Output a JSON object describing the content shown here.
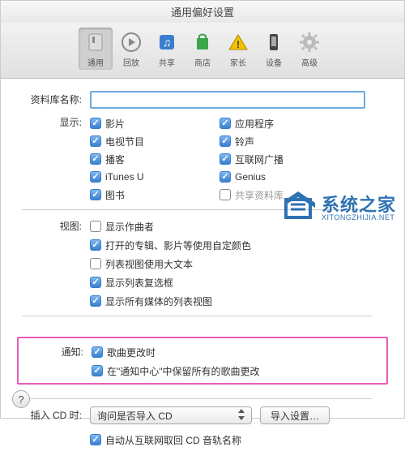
{
  "window": {
    "title": "通用偏好设置"
  },
  "toolbar": {
    "items": [
      {
        "label": "通用",
        "icon": "switch"
      },
      {
        "label": "回放",
        "icon": "play"
      },
      {
        "label": "共享",
        "icon": "music"
      },
      {
        "label": "商店",
        "icon": "bag"
      },
      {
        "label": "家长",
        "icon": "warn"
      },
      {
        "label": "设备",
        "icon": "phone"
      },
      {
        "label": "高级",
        "icon": "gear"
      }
    ]
  },
  "library_name": {
    "label": "资料库名称:",
    "value": ""
  },
  "display": {
    "label": "显示:",
    "col1": [
      {
        "label": "影片",
        "checked": true
      },
      {
        "label": "电视节目",
        "checked": true
      },
      {
        "label": "播客",
        "checked": true
      },
      {
        "label": "iTunes U",
        "checked": true
      },
      {
        "label": "图书",
        "checked": true
      }
    ],
    "col2": [
      {
        "label": "应用程序",
        "checked": true
      },
      {
        "label": "铃声",
        "checked": true
      },
      {
        "label": "互联网广播",
        "checked": true
      },
      {
        "label": "Genius",
        "checked": true
      },
      {
        "label": "共享资料库",
        "checked": false
      }
    ]
  },
  "view": {
    "label": "视图:",
    "items": [
      {
        "label": "显示作曲者",
        "checked": false
      },
      {
        "label": "打开的专辑、影片等使用自定颜色",
        "checked": true
      },
      {
        "label": "列表视图使用大文本",
        "checked": false
      },
      {
        "label": "显示列表复选框",
        "checked": true
      },
      {
        "label": "显示所有媒体的列表视图",
        "checked": true
      }
    ]
  },
  "notify": {
    "label": "通知:",
    "items": [
      {
        "label": "歌曲更改时",
        "checked": true
      },
      {
        "label": "在\"通知中心\"中保留所有的歌曲更改",
        "checked": true
      }
    ]
  },
  "cd": {
    "label": "插入 CD 时:",
    "select_value": "询问是否导入 CD",
    "button": "导入设置…",
    "auto_fetch": {
      "label": "自动从互联网取回 CD 音轨名称",
      "checked": true
    }
  },
  "watermark": {
    "main": "系统之家",
    "sub": "XITONGZHIJIA.NET"
  },
  "help": "?"
}
